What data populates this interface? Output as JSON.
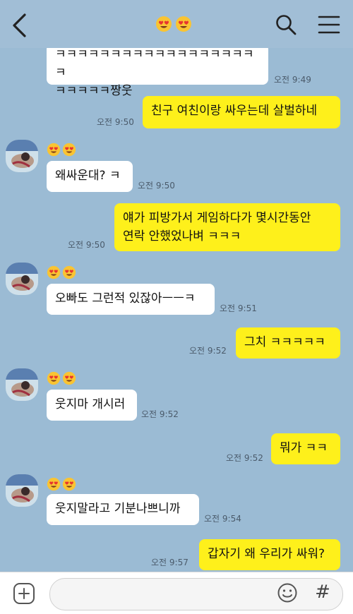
{
  "header": {
    "back_icon": "chevron-left-icon",
    "title_emoji": [
      "heart-eyes-emoji-icon",
      "heart-eyes-emoji-icon"
    ],
    "search_icon": "search-icon",
    "menu_icon": "hamburger-menu-icon"
  },
  "messages": [
    {
      "side": "in",
      "text": "ㅋㅋㅋㅋㅋㅋㅋㅋㅋㅋㅋㅋㅋㅋㅋㅋㅋㅋㅋ\nㅋㅋㅋㅋㅋ짱웃",
      "time": "오전 9:49"
    },
    {
      "side": "out",
      "text": "친구 여친이랑 싸우는데 살벌하네",
      "time": "오전 9:50"
    },
    {
      "side": "in",
      "text": "왜싸운대? ㅋ",
      "time": "오전 9:50"
    },
    {
      "side": "out",
      "text": "얘가 피방가서 게임하다가 몇시간동안\n연락 안했었나벼 ㅋㅋㅋ",
      "time": "오전 9:50"
    },
    {
      "side": "in",
      "text": "오빠도 그런적 있잖아ㅡㅡㅋ",
      "time": "오전 9:51"
    },
    {
      "side": "out",
      "text": "그치 ㅋㅋㅋㅋㅋ",
      "time": "오전 9:52"
    },
    {
      "side": "in",
      "text": "웃지마 개시러",
      "time": "오전 9:52"
    },
    {
      "side": "out",
      "text": "뭐가 ㅋㅋ",
      "time": "오전 9:52"
    },
    {
      "side": "in",
      "text": "웃지말라고 기분나쁘니까",
      "time": "오전 9:54"
    },
    {
      "side": "out",
      "text": "갑자기 왜 우리가 싸워?",
      "time": "오전 9:57"
    }
  ],
  "input_bar": {
    "plus_icon": "plus-square-icon",
    "emoticon_icon": "smiley-icon",
    "hash_symbol": "#"
  },
  "colors": {
    "background": "#9bbbd4",
    "outgoing_bubble": "#fef01b",
    "incoming_bubble": "#ffffff"
  }
}
